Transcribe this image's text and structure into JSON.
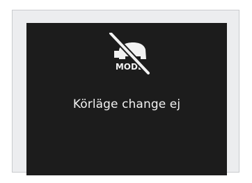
{
  "display": {
    "icon": {
      "name": "mode-disabled-icon",
      "label": "MODE"
    },
    "message": "Körläge change ej",
    "colors": {
      "frame_background": "#ecedef",
      "screen_background": "#1c1c1c",
      "foreground": "#f2f2f2"
    }
  }
}
